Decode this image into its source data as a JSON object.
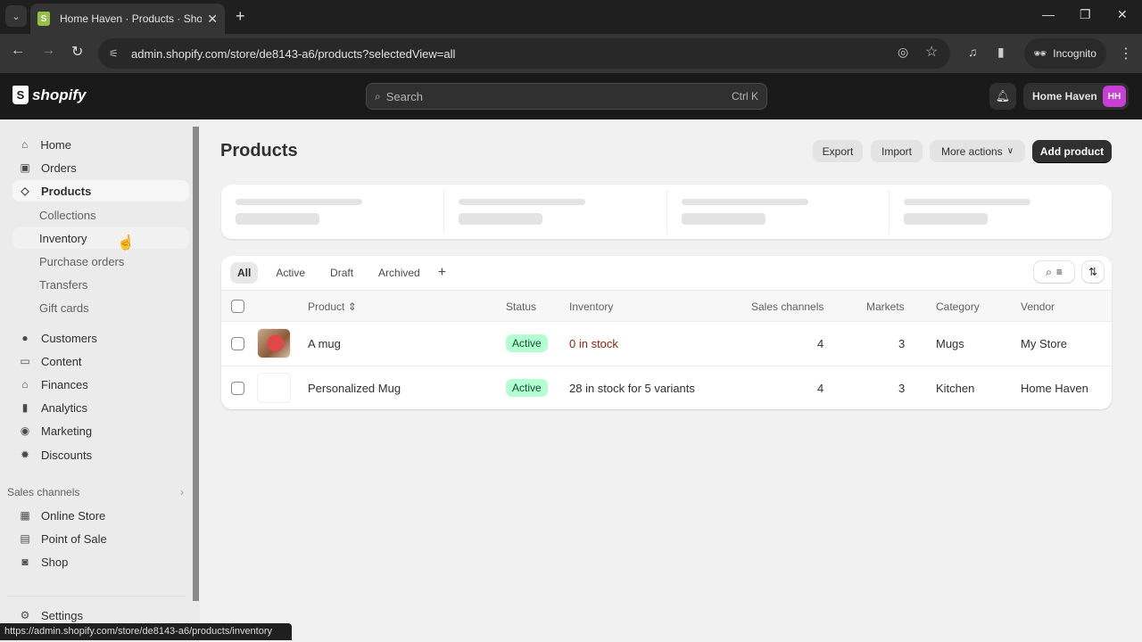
{
  "browser": {
    "tab_title": "Home Haven · Products · Shopify",
    "url": "admin.shopify.com/store/de8143-a6/products?selectedView=all",
    "incognito_label": "Incognito",
    "status_url": "https://admin.shopify.com/store/de8143-a6/products/inventory"
  },
  "topbar": {
    "logo_text": "shopify",
    "search_placeholder": "Search",
    "search_shortcut": "Ctrl K",
    "store_name": "Home Haven",
    "avatar_initials": "HH"
  },
  "sidebar": {
    "items": [
      {
        "label": "Home",
        "icon": "home-icon"
      },
      {
        "label": "Orders",
        "icon": "inbox-icon"
      },
      {
        "label": "Products",
        "icon": "tag-icon"
      }
    ],
    "product_subitems": [
      "Collections",
      "Inventory",
      "Purchase orders",
      "Transfers",
      "Gift cards"
    ],
    "items2": [
      {
        "label": "Customers",
        "icon": "person-icon"
      },
      {
        "label": "Content",
        "icon": "image-icon"
      },
      {
        "label": "Finances",
        "icon": "bank-icon"
      },
      {
        "label": "Analytics",
        "icon": "bar-chart-icon"
      },
      {
        "label": "Marketing",
        "icon": "target-icon"
      },
      {
        "label": "Discounts",
        "icon": "discount-icon"
      }
    ],
    "sales_channels_label": "Sales channels",
    "channels": [
      {
        "label": "Online Store",
        "icon": "store-icon"
      },
      {
        "label": "Point of Sale",
        "icon": "pos-icon"
      },
      {
        "label": "Shop",
        "icon": "shop-icon"
      }
    ],
    "settings_label": "Settings"
  },
  "main": {
    "title": "Products",
    "actions": {
      "export": "Export",
      "import": "Import",
      "more": "More actions",
      "add": "Add product"
    },
    "views": [
      "All",
      "Active",
      "Draft",
      "Archived"
    ],
    "selected_view": "All",
    "columns": {
      "product": "Product",
      "status": "Status",
      "inventory": "Inventory",
      "sales_channels": "Sales channels",
      "markets": "Markets",
      "category": "Category",
      "vendor": "Vendor"
    },
    "rows": [
      {
        "product": "A mug",
        "status": "Active",
        "inventory": "0 in stock",
        "sales_channels": "4",
        "markets": "3",
        "category": "Mugs",
        "vendor": "My Store",
        "has_image": true
      },
      {
        "product": "Personalized Mug",
        "status": "Active",
        "inventory": "28 in stock for 5 variants",
        "sales_channels": "4",
        "markets": "3",
        "category": "Kitchen",
        "vendor": "Home Haven",
        "has_image": false
      }
    ]
  },
  "colors": {
    "active_badge_bg": "#b4fed2",
    "out_of_stock_text": "#8e1f0b",
    "avatar_bg": "#c93fd6",
    "primary_button": "#303030"
  }
}
